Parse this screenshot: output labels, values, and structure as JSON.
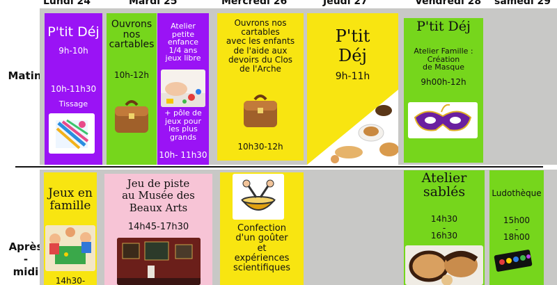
{
  "days": [
    "Lundi 24",
    "Mardi 25",
    "Mercredi 26",
    "Jeudi 27",
    "Vendredi 28",
    "samedi 29"
  ],
  "rows": {
    "morning": "Matin",
    "afternoon": "Après\n-\nmidi"
  },
  "morning": {
    "mon": {
      "title": "P'tit Déj",
      "time1": "9h-10h",
      "time2": "10h-11h30",
      "activity": "Tissage"
    },
    "tue_a": {
      "title": "Ouvrons\nnos\ncartables",
      "time": "10h-12h"
    },
    "tue_b": {
      "title": "Atelier\npetite\nenfance\n1/4 ans\njeux libre",
      "extra": "+ pôle de\njeux pour\nles plus\ngrands",
      "time": "10h- 11h30"
    },
    "wed": {
      "title": "Ouvrons nos\ncartables\navec les enfants\nde l'aide aux\ndevoirs du Clos\nde l'Arche",
      "time": "10h30-12h"
    },
    "thu": {
      "title": "P'tit\nDéj",
      "time": "9h-11h"
    },
    "fri": {
      "title": "P'tit Déj",
      "text": "Atelier Famille :\nCréation\nde Masque",
      "time": "9h00h-12h"
    }
  },
  "afternoon": {
    "mon": {
      "title": "Jeux en\nfamille",
      "time": "14h30-"
    },
    "tue": {
      "title": "Jeu de piste\nau Musée des\nBeaux Arts",
      "time": "14h45-17h30"
    },
    "wed": {
      "title": "Confection\nd'un goûter\net\nexpériences\nscientifiques"
    },
    "fri": {
      "title": "Atelier\nsablés",
      "time1": "14h30",
      "dash": "-",
      "time2": "16h30"
    },
    "sat": {
      "title": "Ludothèque",
      "time1": "15h00",
      "dash": "-",
      "time2": "18h00"
    }
  },
  "colors": {
    "purple": "#9a13f5",
    "green": "#76d61c",
    "yellow": "#f8e511",
    "pink": "#f7c4d6",
    "gray": "#c8c8c6"
  }
}
